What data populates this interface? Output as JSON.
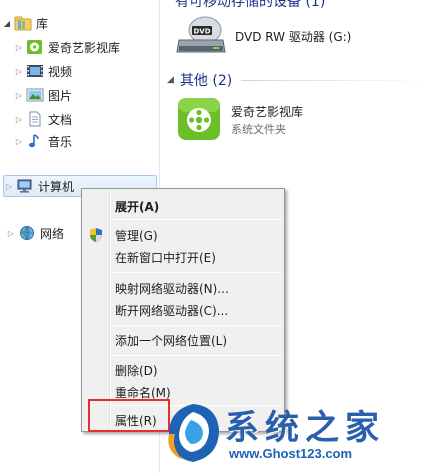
{
  "nav": {
    "items": [
      {
        "label": "库",
        "icon": "library-icon",
        "expanded": true
      },
      {
        "label": "爱奇艺影视库",
        "icon": "iqiyi-library-icon"
      },
      {
        "label": "视频",
        "icon": "video-library-icon"
      },
      {
        "label": "图片",
        "icon": "pictures-library-icon"
      },
      {
        "label": "文档",
        "icon": "documents-library-icon"
      },
      {
        "label": "音乐",
        "icon": "music-library-icon"
      },
      {
        "label": "计算机",
        "icon": "computer-icon",
        "selected": true
      },
      {
        "label": "网络",
        "icon": "network-icon"
      }
    ]
  },
  "content": {
    "top_header_partial": "有可移动存储的设备 (1)",
    "dvd_drive": {
      "label": "DVD RW 驱动器 (G:)",
      "icon": "dvd-drive-icon"
    },
    "other_group": {
      "title": "其他 (2)"
    },
    "iqiyi_folder": {
      "name": "爱奇艺影视库",
      "subtitle": "系统文件夹",
      "icon": "iqiyi-folder-icon"
    }
  },
  "context_menu": {
    "expand": "展开(A)",
    "manage": "管理(G)",
    "open_new_window": "在新窗口中打开(E)",
    "map_drive": "映射网络驱动器(N)...",
    "disconnect_drive": "断开网络驱动器(C)...",
    "add_network_location": "添加一个网络位置(L)",
    "delete": "删除(D)",
    "rename": "重命名(M)",
    "properties": "属性(R)"
  },
  "watermark": {
    "title": "系统之家",
    "url": "www.Ghost123.com"
  },
  "colors": {
    "group_header": "#1e3287",
    "selection_border": "#a9c8ea",
    "highlight_box": "#e1322d",
    "iqiyi_green": "#6cbf2a"
  }
}
